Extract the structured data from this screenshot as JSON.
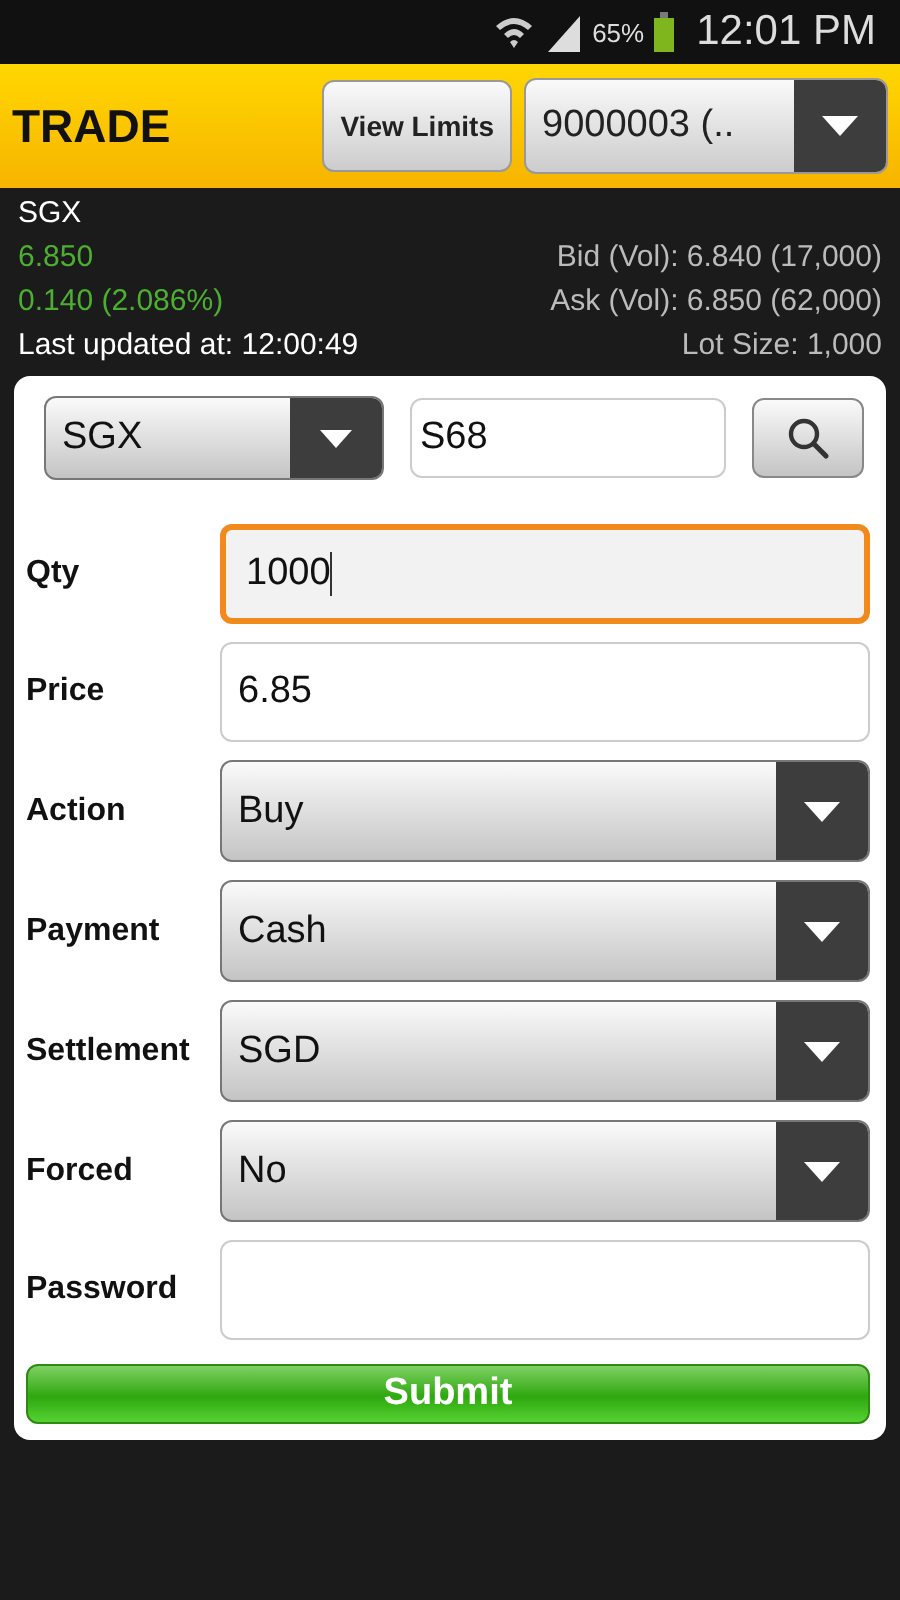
{
  "status_bar": {
    "battery": "65%",
    "time": "12:01 PM"
  },
  "header": {
    "title": "TRADE",
    "view_limits": "View Limits",
    "account": "9000003 (.."
  },
  "quote": {
    "exchange": "SGX",
    "price": "6.850",
    "change": "0.140 (2.086%)",
    "last_updated": "Last updated at: 12:00:49",
    "bid": "Bid (Vol): 6.840 (17,000)",
    "ask": "Ask (Vol): 6.850 (62,000)",
    "lot_size": "Lot Size: 1,000"
  },
  "search": {
    "exchange": "SGX",
    "symbol": "S68"
  },
  "fields": [
    {
      "label": "Qty",
      "kind": "text",
      "value": "1000",
      "focused": true
    },
    {
      "label": "Price",
      "kind": "text",
      "value": "6.85",
      "focused": false
    },
    {
      "label": "Action",
      "kind": "select",
      "value": "Buy"
    },
    {
      "label": "Payment",
      "kind": "select",
      "value": "Cash"
    },
    {
      "label": "Settlement",
      "kind": "select",
      "value": "SGD"
    },
    {
      "label": "Forced",
      "kind": "select",
      "value": "No"
    },
    {
      "label": "Password",
      "kind": "text",
      "focused": false
    }
  ],
  "submit": "Submit"
}
